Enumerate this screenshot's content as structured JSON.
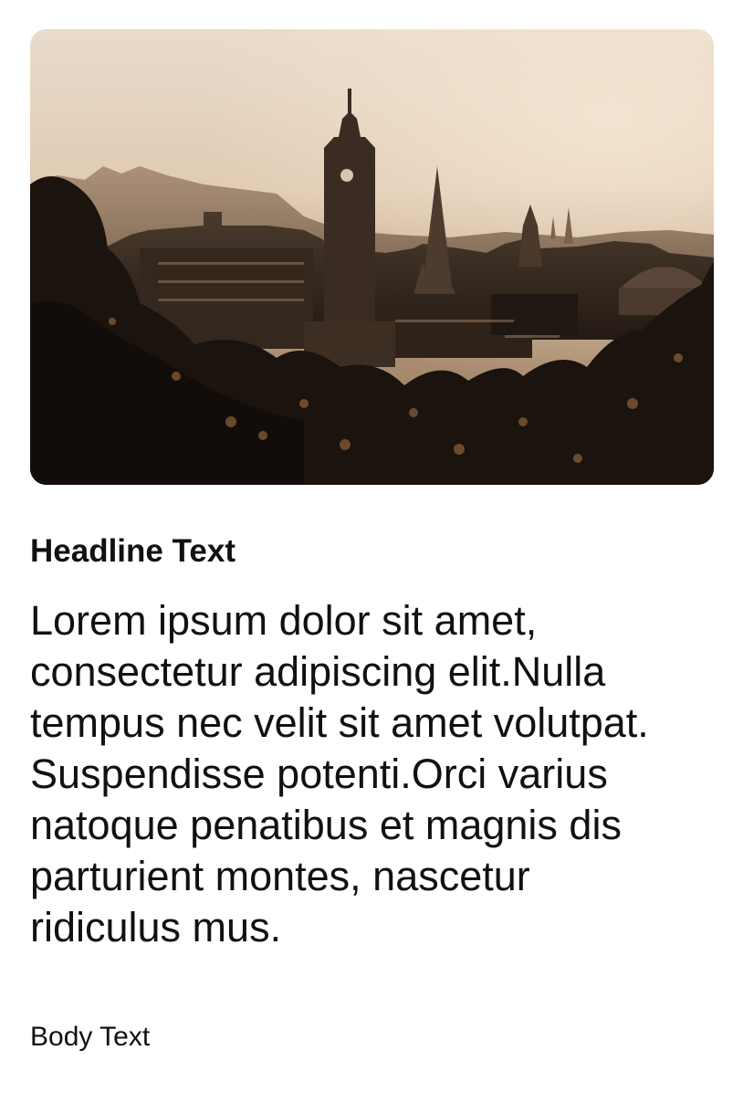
{
  "card": {
    "image_alt": "City skyline at sunset with clock tower",
    "headline": "Headline Text",
    "lead_lines": [
      "Lorem ipsum dolor sit amet,",
      "consectetur adipiscing elit.Nulla",
      "tempus nec velit sit amet volutpat.",
      "Suspendisse potenti.Orci varius",
      "natoque penatibus et magnis dis",
      "parturient montes, nascetur",
      "ridiculus mus."
    ],
    "caption": "Body Text"
  },
  "colors": {
    "text": "#111111",
    "background": "#ffffff",
    "sky_top": "#eadccb",
    "sky_mid": "#c6aa8c",
    "silhouette": "#2a1f17"
  }
}
